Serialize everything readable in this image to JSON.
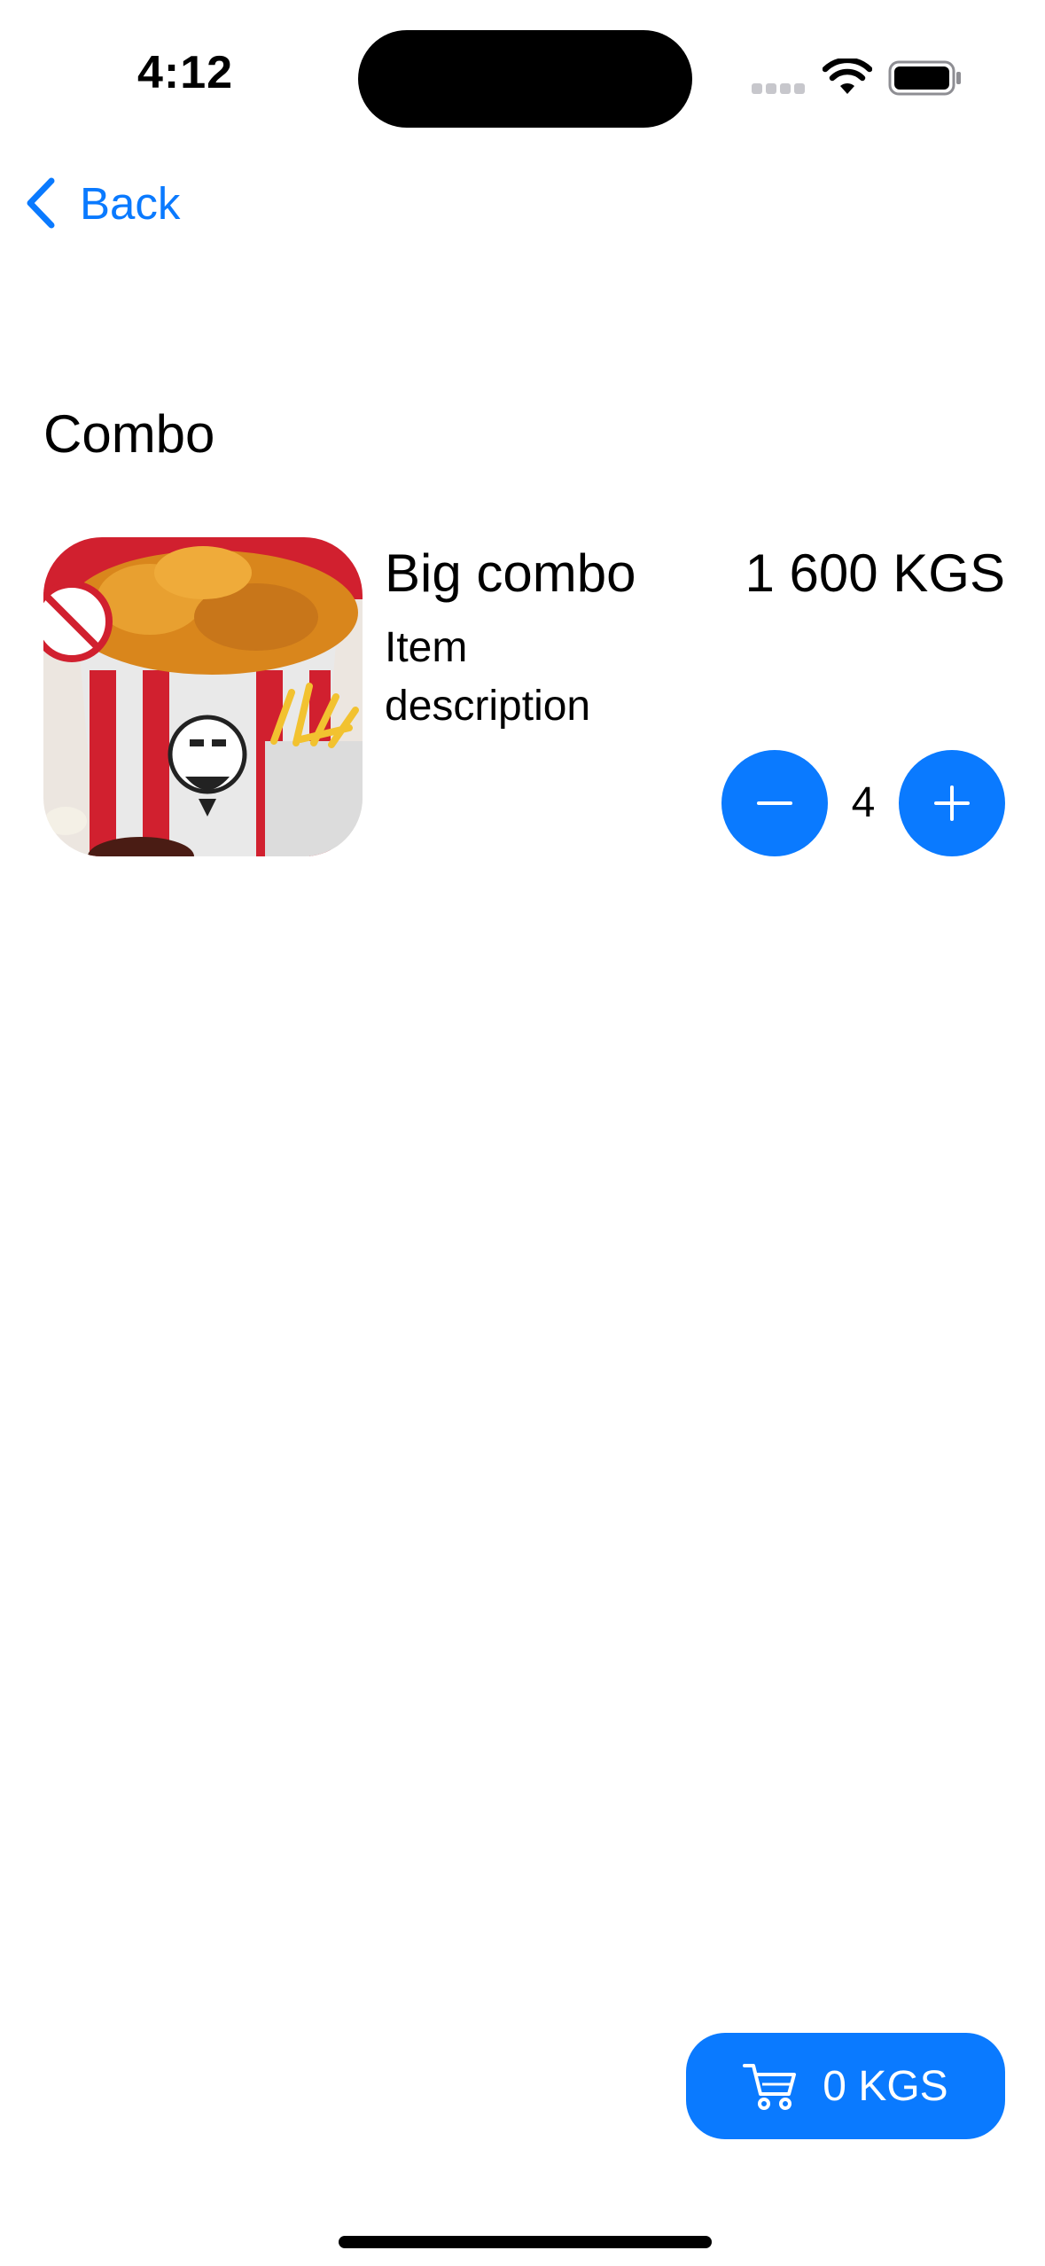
{
  "status_bar": {
    "time": "4:12",
    "icons": [
      "cellular-signal-icon",
      "wifi-icon",
      "battery-icon"
    ]
  },
  "nav": {
    "back_label": "Back"
  },
  "section": {
    "title": "Combo"
  },
  "item": {
    "name": "Big combo",
    "description": "Item description",
    "price": "1 600 KGS",
    "quantity": "4",
    "image": "kfc-bucket-image"
  },
  "cart": {
    "total": "0 KGS",
    "icon": "cart-icon"
  },
  "colors": {
    "accent": "#0a7aff",
    "background": "#ffffff",
    "text": "#000000"
  }
}
